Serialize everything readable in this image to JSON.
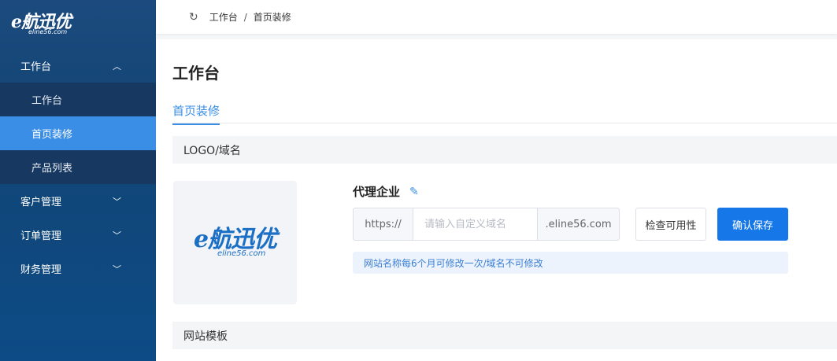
{
  "sidebar": {
    "logo": {
      "text": "e航迅优",
      "sub": "eline56.com"
    },
    "groups": [
      {
        "label": "工作台",
        "expanded": true,
        "items": [
          {
            "label": "工作台",
            "active": false
          },
          {
            "label": "首页装修",
            "active": true
          },
          {
            "label": "产品列表",
            "active": false
          }
        ]
      },
      {
        "label": "客户管理",
        "expanded": false
      },
      {
        "label": "订单管理",
        "expanded": false
      },
      {
        "label": "财务管理",
        "expanded": false
      }
    ]
  },
  "topbar": {
    "breadcrumb": [
      "工作台",
      "首页装修"
    ],
    "separator": "/"
  },
  "main": {
    "title": "工作台",
    "tab": "首页装修",
    "section_logo": "LOGO/域名",
    "logo_preview": {
      "text": "e航迅优",
      "sub": "eline56.com"
    },
    "company_name": "代理企业",
    "domain": {
      "prefix": "https://",
      "placeholder": "请输入自定义域名",
      "suffix": ".eline56.com"
    },
    "check_button": "检查可用性",
    "save_button": "确认保存",
    "hint": "网站名称每6个月可修改一次/域名不可修改",
    "section_template": "网站模板"
  },
  "colors": {
    "accent": "#3a8ee6",
    "primary_button": "#1677e8",
    "sidebar_bg": "#124575"
  }
}
